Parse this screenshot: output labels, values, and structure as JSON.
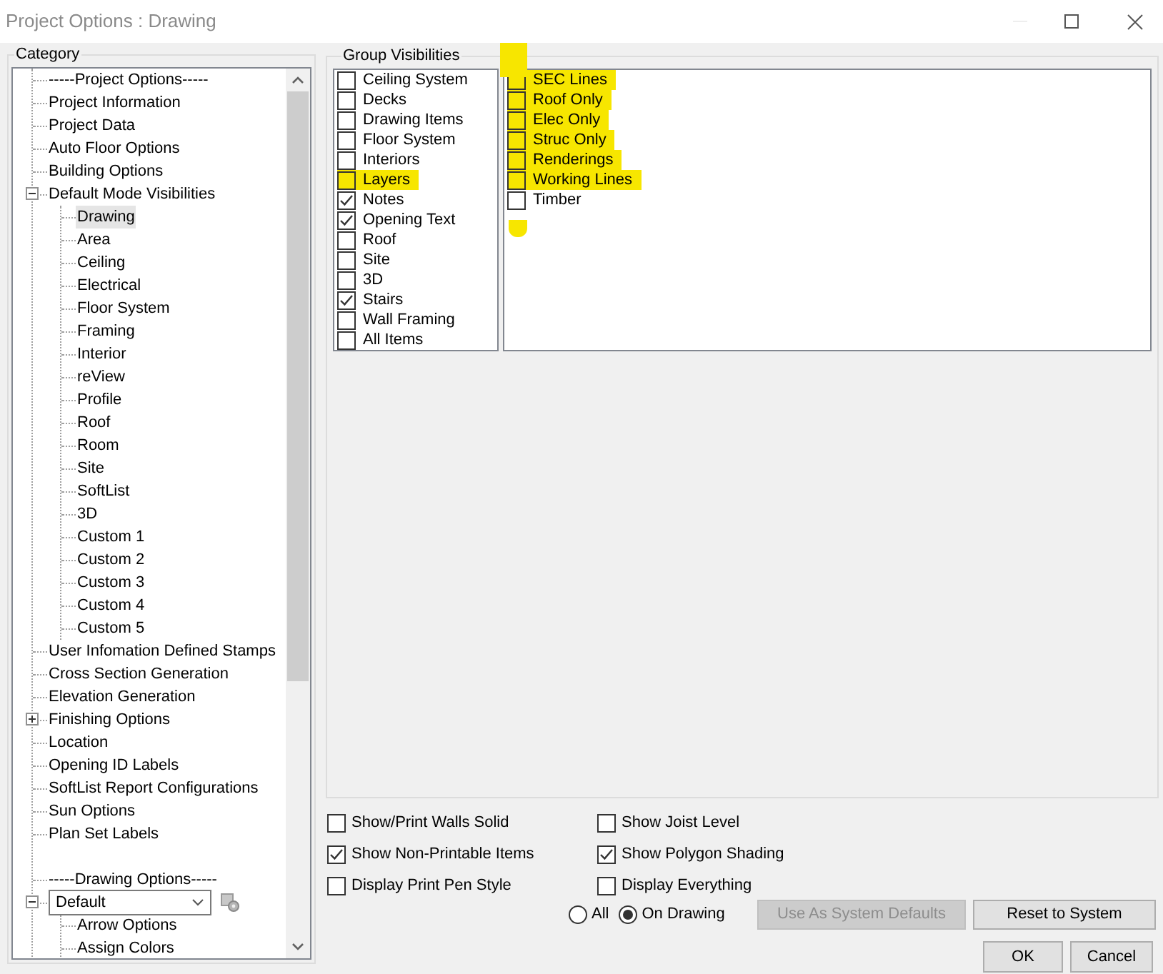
{
  "window": {
    "title": "Project Options : Drawing"
  },
  "category": {
    "title": "Category",
    "tree": [
      {
        "label": "-----Project Options-----",
        "selected": false
      },
      {
        "label": "Project Information",
        "selected": false
      },
      {
        "label": "Project Data",
        "selected": false
      },
      {
        "label": "Auto Floor Options",
        "selected": false
      },
      {
        "label": "Building Options",
        "selected": false
      },
      {
        "label": "Default Mode Visibilities",
        "selected": false,
        "expanded": true,
        "children": [
          {
            "label": "Drawing",
            "selected": true
          },
          {
            "label": "Area",
            "selected": false
          },
          {
            "label": "Ceiling",
            "selected": false
          },
          {
            "label": "Electrical",
            "selected": false
          },
          {
            "label": "Floor System",
            "selected": false
          },
          {
            "label": "Framing",
            "selected": false
          },
          {
            "label": "Interior",
            "selected": false
          },
          {
            "label": "reView",
            "selected": false
          },
          {
            "label": "Profile",
            "selected": false
          },
          {
            "label": "Roof",
            "selected": false
          },
          {
            "label": "Room",
            "selected": false
          },
          {
            "label": "Site",
            "selected": false
          },
          {
            "label": "SoftList",
            "selected": false
          },
          {
            "label": "3D",
            "selected": false
          },
          {
            "label": "Custom 1",
            "selected": false
          },
          {
            "label": "Custom 2",
            "selected": false
          },
          {
            "label": "Custom 3",
            "selected": false
          },
          {
            "label": "Custom 4",
            "selected": false
          },
          {
            "label": "Custom 5",
            "selected": false
          }
        ]
      },
      {
        "label": "User Infomation Defined Stamps",
        "selected": false
      },
      {
        "label": "Cross Section Generation",
        "selected": false
      },
      {
        "label": "Elevation Generation",
        "selected": false
      },
      {
        "label": "Finishing Options",
        "selected": false,
        "expanded": false
      },
      {
        "label": "Location",
        "selected": false
      },
      {
        "label": "Opening ID Labels",
        "selected": false
      },
      {
        "label": "SoftList Report Configurations",
        "selected": false
      },
      {
        "label": "Sun Options",
        "selected": false
      },
      {
        "label": "Plan Set Labels",
        "selected": false
      },
      {
        "label": "-----Drawing Options-----",
        "selected": false,
        "gap_before": true
      },
      {
        "label": "Default",
        "kind": "dropdown",
        "selected": false,
        "expanded": true,
        "children": [
          {
            "label": "Arrow Options",
            "selected": false
          },
          {
            "label": "Assign Colors",
            "selected": false
          }
        ]
      }
    ]
  },
  "group_visibilities": {
    "title": "Group Visibilities",
    "left_list": [
      {
        "label": "Ceiling System",
        "checked": false,
        "highlighted": false
      },
      {
        "label": "Decks",
        "checked": false,
        "highlighted": false
      },
      {
        "label": "Drawing Items",
        "checked": false,
        "highlighted": false
      },
      {
        "label": "Floor System",
        "checked": false,
        "highlighted": false
      },
      {
        "label": "Interiors",
        "checked": false,
        "highlighted": false
      },
      {
        "label": "Layers",
        "checked": false,
        "highlighted": true
      },
      {
        "label": "Notes",
        "checked": true,
        "highlighted": false
      },
      {
        "label": "Opening Text",
        "checked": true,
        "highlighted": false
      },
      {
        "label": "Roof",
        "checked": false,
        "highlighted": false
      },
      {
        "label": "Site",
        "checked": false,
        "highlighted": false
      },
      {
        "label": "3D",
        "checked": false,
        "highlighted": false
      },
      {
        "label": "Stairs",
        "checked": true,
        "highlighted": false
      },
      {
        "label": "Wall Framing",
        "checked": false,
        "highlighted": false
      },
      {
        "label": "All Items",
        "checked": false,
        "highlighted": false
      }
    ],
    "right_list": [
      {
        "label": "SEC Lines",
        "checked": false,
        "highlighted": true
      },
      {
        "label": "Roof Only",
        "checked": false,
        "highlighted": true
      },
      {
        "label": "Elec Only",
        "checked": false,
        "highlighted": true
      },
      {
        "label": "Struc Only",
        "checked": false,
        "highlighted": true
      },
      {
        "label": "Renderings",
        "checked": false,
        "highlighted": true
      },
      {
        "label": "Working Lines",
        "checked": false,
        "highlighted": true
      },
      {
        "label": "Timber",
        "checked": false,
        "highlighted": false
      }
    ]
  },
  "display_options": [
    {
      "label": "Show/Print Walls Solid",
      "checked": false
    },
    {
      "label": "Show Joist Level",
      "checked": false
    },
    {
      "label": "Show Non-Printable Items",
      "checked": true
    },
    {
      "label": "Show Polygon Shading",
      "checked": true
    },
    {
      "label": "Display Print Pen Style",
      "checked": false
    },
    {
      "label": "Display Everything",
      "checked": false
    }
  ],
  "scope": [
    {
      "label": "All",
      "selected": false
    },
    {
      "label": "On Drawing",
      "selected": true
    }
  ],
  "buttons": [
    {
      "label": "Use As System Defaults",
      "disabled": true
    },
    {
      "label": "Reset to System",
      "disabled": false
    }
  ],
  "dialog_buttons": [
    {
      "label": "OK"
    },
    {
      "label": "Cancel"
    }
  ]
}
